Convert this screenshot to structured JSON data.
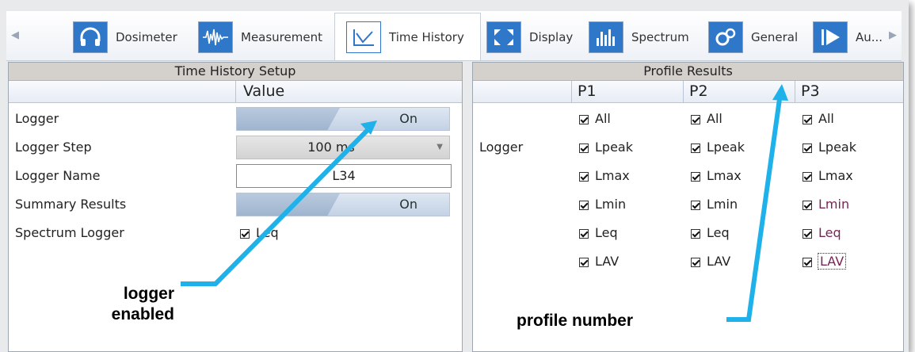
{
  "tabs": [
    {
      "label": "Dosimeter",
      "icon": "headphones-icon"
    },
    {
      "label": "Measurement",
      "icon": "waveform-icon"
    },
    {
      "label": "Time History",
      "icon": "line-chart-icon"
    },
    {
      "label": "Display",
      "icon": "display-arrows-icon"
    },
    {
      "label": "Spectrum",
      "icon": "bar-spectrum-icon"
    },
    {
      "label": "General",
      "icon": "gears-icon"
    },
    {
      "label": "Au...",
      "icon": "play-icon"
    }
  ],
  "active_tab": "Time History",
  "setup": {
    "title": "Time History Setup",
    "value_header": "Value",
    "rows": [
      {
        "label": "Logger",
        "value": "On"
      },
      {
        "label": "Logger Step",
        "value": "100 ms"
      },
      {
        "label": "Logger Name",
        "value": "L34"
      },
      {
        "label": "Summary Results",
        "value": "On"
      },
      {
        "label": "Spectrum Logger",
        "value": "Leq",
        "checked": true
      }
    ]
  },
  "profile": {
    "title": "Profile Results",
    "columns": [
      "P1",
      "P2",
      "P3"
    ],
    "row_label": "Logger",
    "items": [
      "All",
      "Lpeak",
      "Lmax",
      "Lmin",
      "Leq",
      "LAV"
    ],
    "checked": true
  },
  "annotations": {
    "left": "logger enabled",
    "left_line1": "logger",
    "left_line2": "enabled",
    "right": "profile number",
    "arrow_color": "#1fb1ea"
  },
  "colors": {
    "panel_title_bg": "#d4d1cc",
    "p3_highlight_text": "#7b2355"
  }
}
